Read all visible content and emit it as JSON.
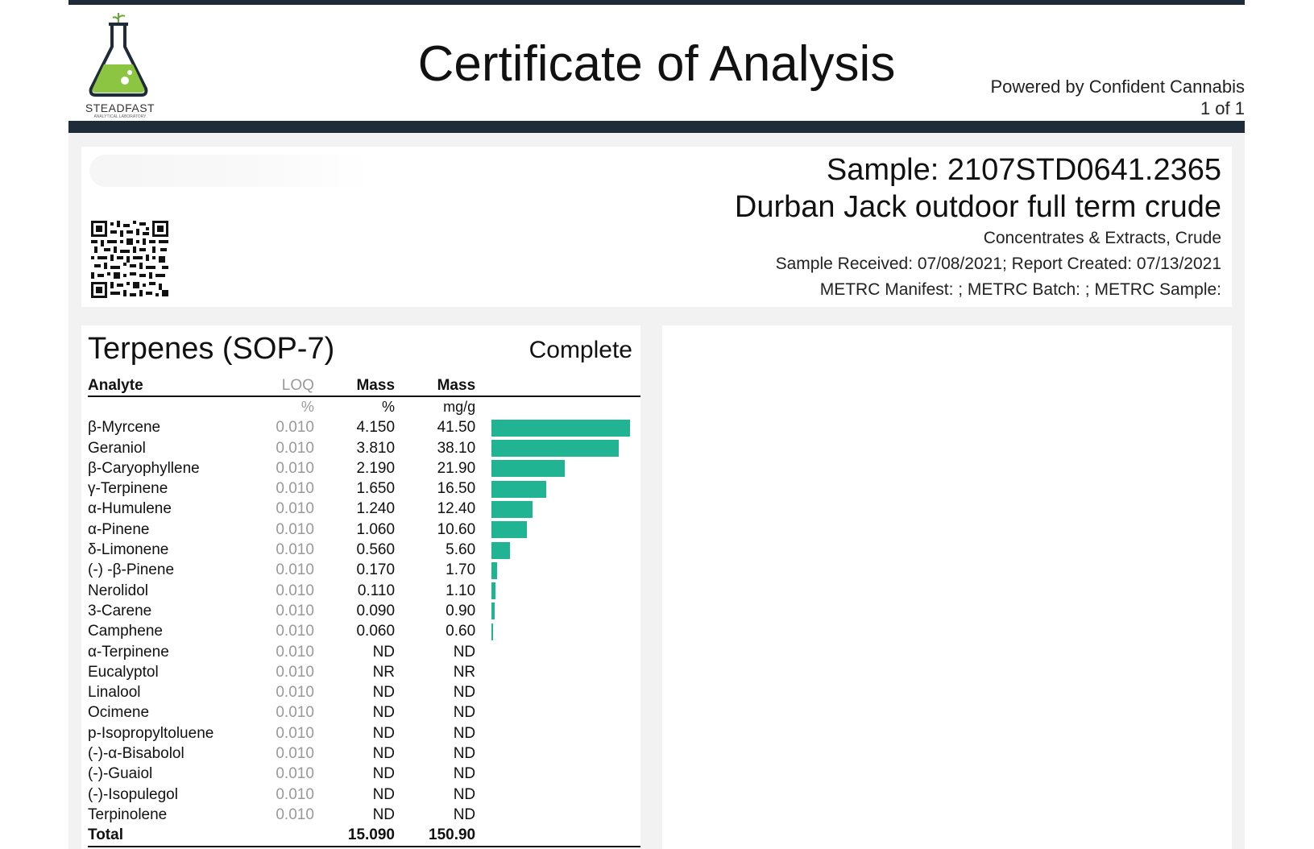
{
  "header": {
    "logo_name": "STEADFAST",
    "logo_sub": "ANALYTICAL LABORATORY",
    "title": "Certificate of Analysis",
    "powered_by": "Powered by Confident Cannabis",
    "page": "1 of 1"
  },
  "sample": {
    "id": "Sample: 2107STD0641.2365",
    "name": "Durban Jack outdoor full term crude",
    "category": "Concentrates & Extracts, Crude",
    "dates": "Sample Received: 07/08/2021; Report Created: 07/13/2021",
    "metrc": "METRC Manifest: ; METRC Batch: ; METRC Sample:"
  },
  "terpenes": {
    "title": "Terpenes (SOP-7)",
    "status": "Complete",
    "columns": {
      "analyte": "Analyte",
      "loq": "LOQ",
      "mass1": "Mass",
      "mass2": "Mass"
    },
    "units": {
      "loq": "%",
      "mass1": "%",
      "mass2": "mg/g"
    },
    "rows": [
      {
        "analyte": "β-Myrcene",
        "loq": "0.010",
        "pct": "4.150",
        "mg": "41.50"
      },
      {
        "analyte": "Geraniol",
        "loq": "0.010",
        "pct": "3.810",
        "mg": "38.10"
      },
      {
        "analyte": "β-Caryophyllene",
        "loq": "0.010",
        "pct": "2.190",
        "mg": "21.90"
      },
      {
        "analyte": "γ-Terpinene",
        "loq": "0.010",
        "pct": "1.650",
        "mg": "16.50"
      },
      {
        "analyte": "α-Humulene",
        "loq": "0.010",
        "pct": "1.240",
        "mg": "12.40"
      },
      {
        "analyte": "α-Pinene",
        "loq": "0.010",
        "pct": "1.060",
        "mg": "10.60"
      },
      {
        "analyte": "δ-Limonene",
        "loq": "0.010",
        "pct": "0.560",
        "mg": "5.60"
      },
      {
        "analyte": "(-) -β-Pinene",
        "loq": "0.010",
        "pct": "0.170",
        "mg": "1.70"
      },
      {
        "analyte": "Nerolidol",
        "loq": "0.010",
        "pct": "0.110",
        "mg": "1.10"
      },
      {
        "analyte": "3-Carene",
        "loq": "0.010",
        "pct": "0.090",
        "mg": "0.90"
      },
      {
        "analyte": "Camphene",
        "loq": "0.010",
        "pct": "0.060",
        "mg": "0.60"
      },
      {
        "analyte": "α-Terpinene",
        "loq": "0.010",
        "pct": "ND",
        "mg": "ND"
      },
      {
        "analyte": "Eucalyptol",
        "loq": "0.010",
        "pct": "NR",
        "mg": "NR"
      },
      {
        "analyte": "Linalool",
        "loq": "0.010",
        "pct": "ND",
        "mg": "ND"
      },
      {
        "analyte": "Ocimene",
        "loq": "0.010",
        "pct": "ND",
        "mg": "ND"
      },
      {
        "analyte": "p-Isopropyltoluene",
        "loq": "0.010",
        "pct": "ND",
        "mg": "ND"
      },
      {
        "analyte": "(-)-α-Bisabolol",
        "loq": "0.010",
        "pct": "ND",
        "mg": "ND"
      },
      {
        "analyte": "(-)-Guaiol",
        "loq": "0.010",
        "pct": "ND",
        "mg": "ND"
      },
      {
        "analyte": "(-)-Isopulegol",
        "loq": "0.010",
        "pct": "ND",
        "mg": "ND"
      },
      {
        "analyte": "Terpinolene",
        "loq": "0.010",
        "pct": "ND",
        "mg": "ND"
      }
    ],
    "total": {
      "label": "Total",
      "pct": "15.090",
      "mg": "150.90"
    },
    "bar_color": "#21b493",
    "bar_max_mg": 41.5
  }
}
